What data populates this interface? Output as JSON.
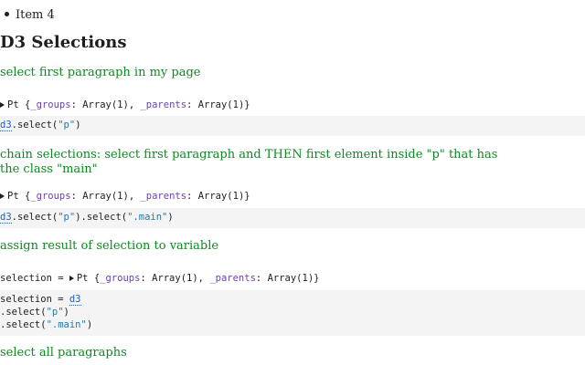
{
  "list": {
    "item4": "Item 4"
  },
  "heading": "D3 Selections",
  "cells": [
    {
      "comment": "select first paragraph in my page",
      "output": {
        "name": "Pt",
        "k1": "_groups",
        "v1": "Array(1)",
        "k2": "_parents",
        "v2": "Array(1)"
      },
      "code": {
        "obj": "d3",
        "m1": ".select(",
        "s1": "\"p\"",
        "c1": ")"
      }
    },
    {
      "comment_line1": "chain selections: select first paragraph and THEN first element inside \"p\" that has",
      "comment_line2": "the class \"main\"",
      "output": {
        "name": "Pt",
        "k1": "_groups",
        "v1": "Array(1)",
        "k2": "_parents",
        "v2": "Array(1)"
      },
      "code": {
        "obj": "d3",
        "m1": ".select(",
        "s1": "\"p\"",
        "m2": ").select(",
        "s2": "\".main\"",
        "c2": ")"
      }
    },
    {
      "comment": "assign result of selection to variable",
      "output": {
        "lhs": "selection = ",
        "name": "Pt",
        "k1": "_groups",
        "v1": "Array(1)",
        "k2": "_parents",
        "v2": "Array(1)"
      },
      "code": {
        "lhs": "selection = ",
        "obj": "d3",
        "m1": ".select(",
        "s1": "\"p\"",
        "c1": ")",
        "m2": ".select(",
        "s2": "\".main\"",
        "c2": ")"
      }
    },
    {
      "comment": "select all paragraphs"
    }
  ],
  "colors": {
    "comment": "#0b8a1f",
    "key": "#6a3fb8",
    "string": "#1f78b4",
    "code_bg": "#f4f4f5"
  }
}
